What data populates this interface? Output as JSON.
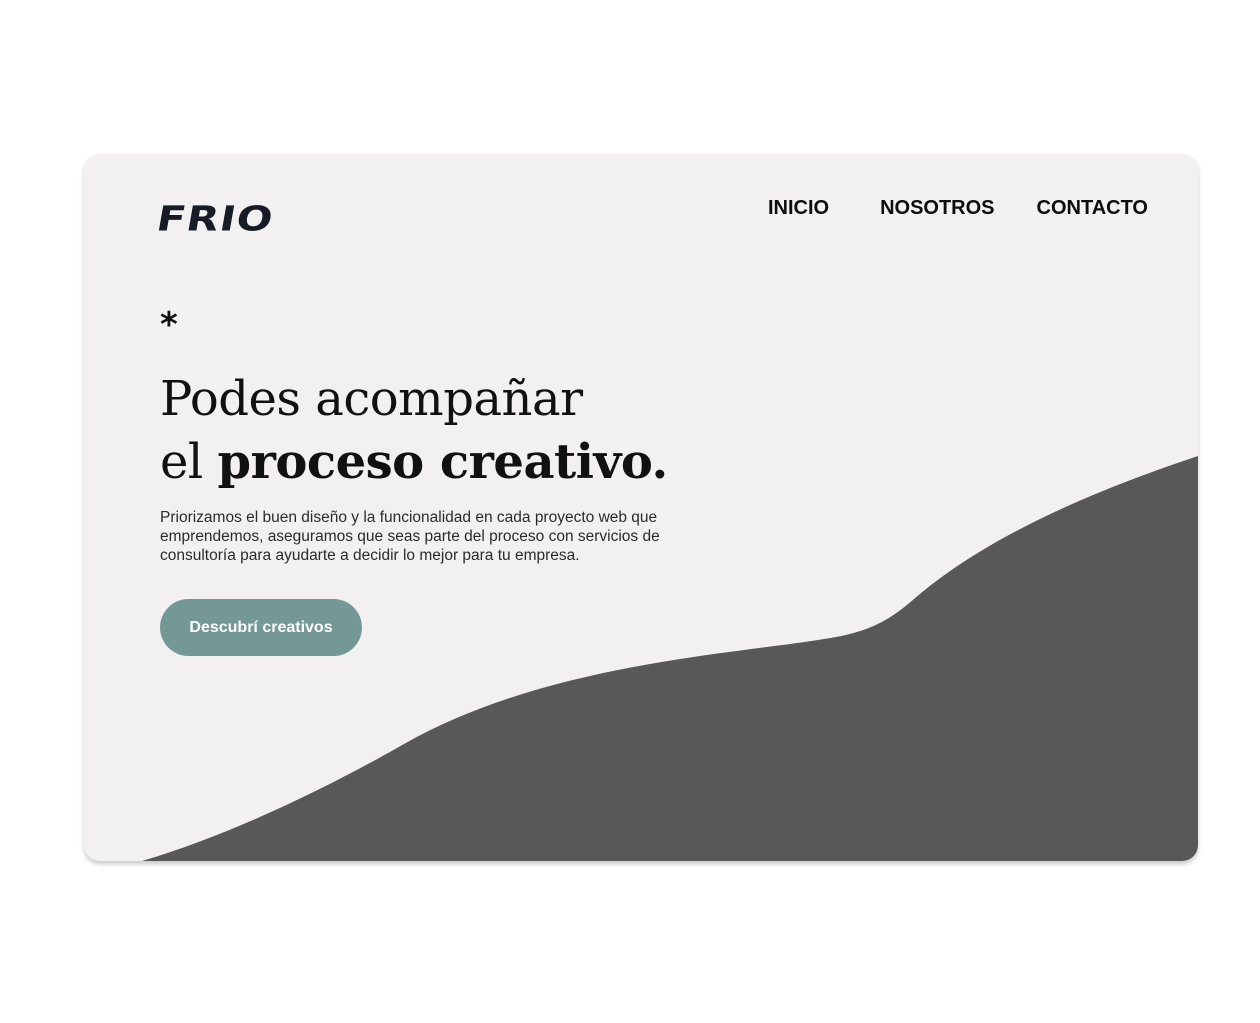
{
  "brand": {
    "logo_text": "FRIO"
  },
  "nav": {
    "items": [
      {
        "label": "INICIO"
      },
      {
        "label": "NOSOTROS"
      },
      {
        "label": "CONTACTO"
      }
    ]
  },
  "hero": {
    "asterisk": "*",
    "headline_line1": "Podes acompañar",
    "headline_line2_prefix": "el ",
    "headline_line2_bold": "proceso creativo.",
    "description": "Priorizamos el buen diseño y la funcionalidad en cada proyecto web que emprendemos, aseguramos que seas parte del proceso con servicios de consultoría para ayudarte a decidir lo mejor para tu empresa.",
    "cta_label": "Descubrí creativos"
  },
  "colors": {
    "card_background": "#f2f0f1",
    "wave": "#585858",
    "cta": "#739895",
    "logo": "#171b26"
  }
}
